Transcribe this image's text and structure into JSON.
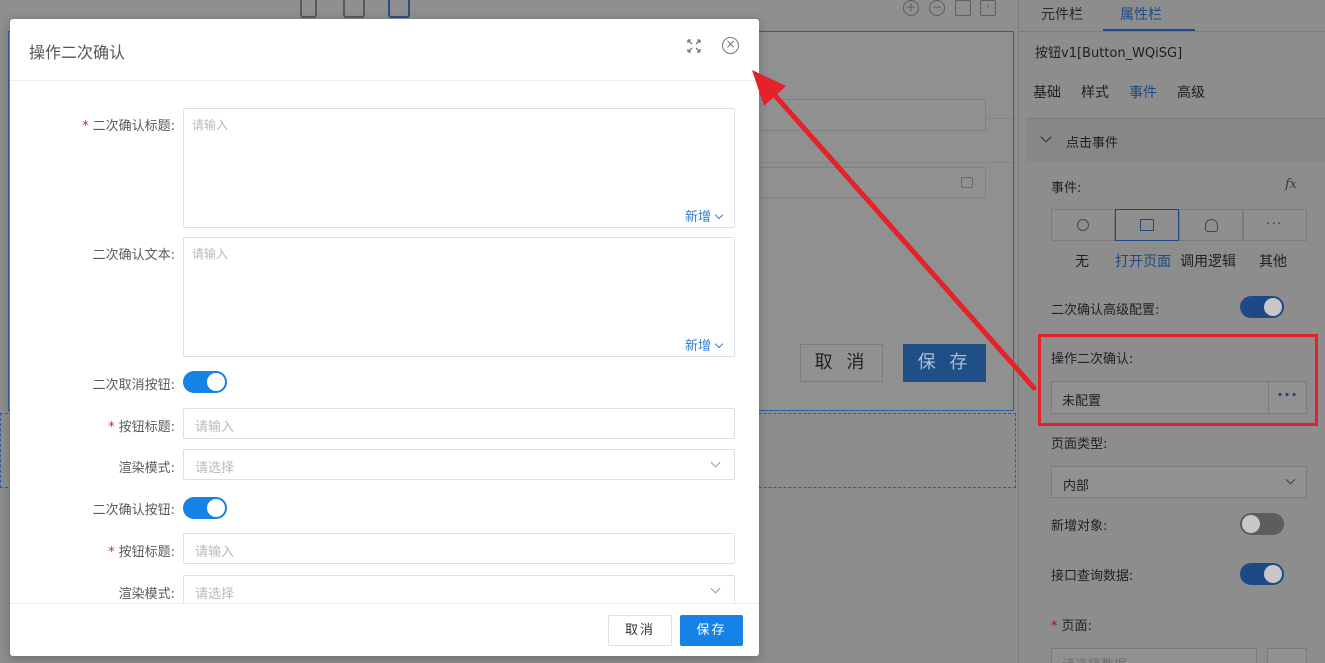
{
  "canvas": {
    "cancel_label": "取 消",
    "save_label": "保 存"
  },
  "right_panel": {
    "tabs": [
      {
        "label": "元件栏"
      },
      {
        "label": "属性栏",
        "active": true
      }
    ],
    "component_title": "按钮v1[Button_WQiSG]",
    "subtabs": [
      {
        "label": "基础"
      },
      {
        "label": "样式"
      },
      {
        "label": "事件",
        "active": true
      },
      {
        "label": "高级"
      }
    ],
    "section_title": "点击事件",
    "event_label": "事件:",
    "fx_icon": "fx",
    "event_options": [
      {
        "label": "无",
        "icon": "forbidden-icon"
      },
      {
        "label": "打开页面",
        "icon": "window-icon",
        "active": true
      },
      {
        "label": "调用逻辑",
        "icon": "logic-icon"
      },
      {
        "label": "其他",
        "icon": "more-icon"
      }
    ],
    "advanced_confirm_label": "二次确认高级配置:",
    "advanced_confirm_on": true,
    "operation_confirm_label": "操作二次确认:",
    "operation_confirm_value": "未配置",
    "page_type_label": "页面类型:",
    "page_type_value": "内部",
    "new_object_label": "新增对象:",
    "new_object_on": false,
    "api_query_label": "接口查询数据:",
    "api_query_on": true,
    "page_label": "页面:",
    "page_placeholder": "请选择数据"
  },
  "modal": {
    "title": "操作二次确认",
    "fields": {
      "confirm_title": {
        "label": "二次确认标题:",
        "required": true,
        "placeholder": "请输入",
        "add_label": "新增"
      },
      "confirm_text": {
        "label": "二次确认文本:",
        "required": false,
        "placeholder": "请输入",
        "add_label": "新增"
      },
      "cancel_button_toggle": {
        "label": "二次取消按钮:",
        "on": true
      },
      "cancel_button_title": {
        "label": "按钮标题:",
        "required": true,
        "placeholder": "请输入"
      },
      "cancel_render_mode": {
        "label": "渲染模式:",
        "placeholder": "请选择"
      },
      "confirm_button_toggle": {
        "label": "二次确认按钮:",
        "on": true
      },
      "confirm_button_title": {
        "label": "按钮标题:",
        "required": true,
        "placeholder": "请输入"
      },
      "confirm_render_mode": {
        "label": "渲染模式:",
        "placeholder": "请选择"
      }
    },
    "footer": {
      "cancel_label": "取消",
      "save_label": "保存"
    }
  },
  "colors": {
    "primary": "#1682e6",
    "link": "#2f80d5",
    "required": "#e02020",
    "annotation": "#e5222a",
    "overlay": "#8d8d8d"
  }
}
